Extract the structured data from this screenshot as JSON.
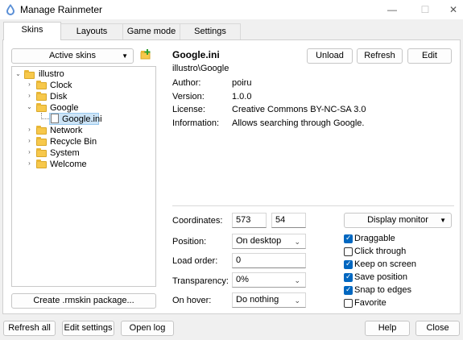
{
  "window": {
    "title": "Manage Rainmeter",
    "minimize_glyph": "—",
    "maximize_glyph": "☐",
    "close_glyph": "✕"
  },
  "tabs": [
    {
      "label": "Skins",
      "active": true
    },
    {
      "label": "Layouts",
      "active": false
    },
    {
      "label": "Game mode",
      "active": false
    },
    {
      "label": "Settings",
      "active": false
    }
  ],
  "left": {
    "active_skins_label": "Active skins",
    "add_icon": "add-folder-icon",
    "create_package_label": "Create .rmskin package..."
  },
  "tree": {
    "root": "illustro",
    "children": [
      "Clock",
      "Disk",
      "Google",
      "Network",
      "Recycle Bin",
      "System",
      "Welcome"
    ],
    "google_file": "Google.ini"
  },
  "skin": {
    "name": "Google.ini",
    "path": "illustro\\Google",
    "unload_label": "Unload",
    "refresh_label": "Refresh",
    "edit_label": "Edit",
    "author_label": "Author:",
    "author": "poiru",
    "version_label": "Version:",
    "version": "1.0.0",
    "license_label": "License:",
    "license": "Creative Commons BY-NC-SA 3.0",
    "information_label": "Information:",
    "information": "Allows searching through Google."
  },
  "settings": {
    "coordinates_label": "Coordinates:",
    "coord_x": "573",
    "coord_y": "54",
    "display_monitor_label": "Display monitor",
    "position_label": "Position:",
    "position": "On desktop",
    "load_order_label": "Load order:",
    "load_order": "0",
    "transparency_label": "Transparency:",
    "transparency": "0%",
    "on_hover_label": "On hover:",
    "on_hover": "Do nothing",
    "options": {
      "draggable": "Draggable",
      "click_through": "Click through",
      "keep_on_screen": "Keep on screen",
      "save_position": "Save position",
      "snap_to_edges": "Snap to edges",
      "favorite": "Favorite"
    },
    "checked": {
      "draggable": true,
      "click_through": false,
      "keep_on_screen": true,
      "save_position": true,
      "snap_to_edges": true,
      "favorite": false
    }
  },
  "footer": {
    "refresh_all": "Refresh all",
    "edit_settings": "Edit settings",
    "open_log": "Open log",
    "help": "Help",
    "close": "Close"
  },
  "colors": {
    "accent": "#0067c0",
    "selection": "#cce4f7",
    "folder": "#f7c84b"
  }
}
